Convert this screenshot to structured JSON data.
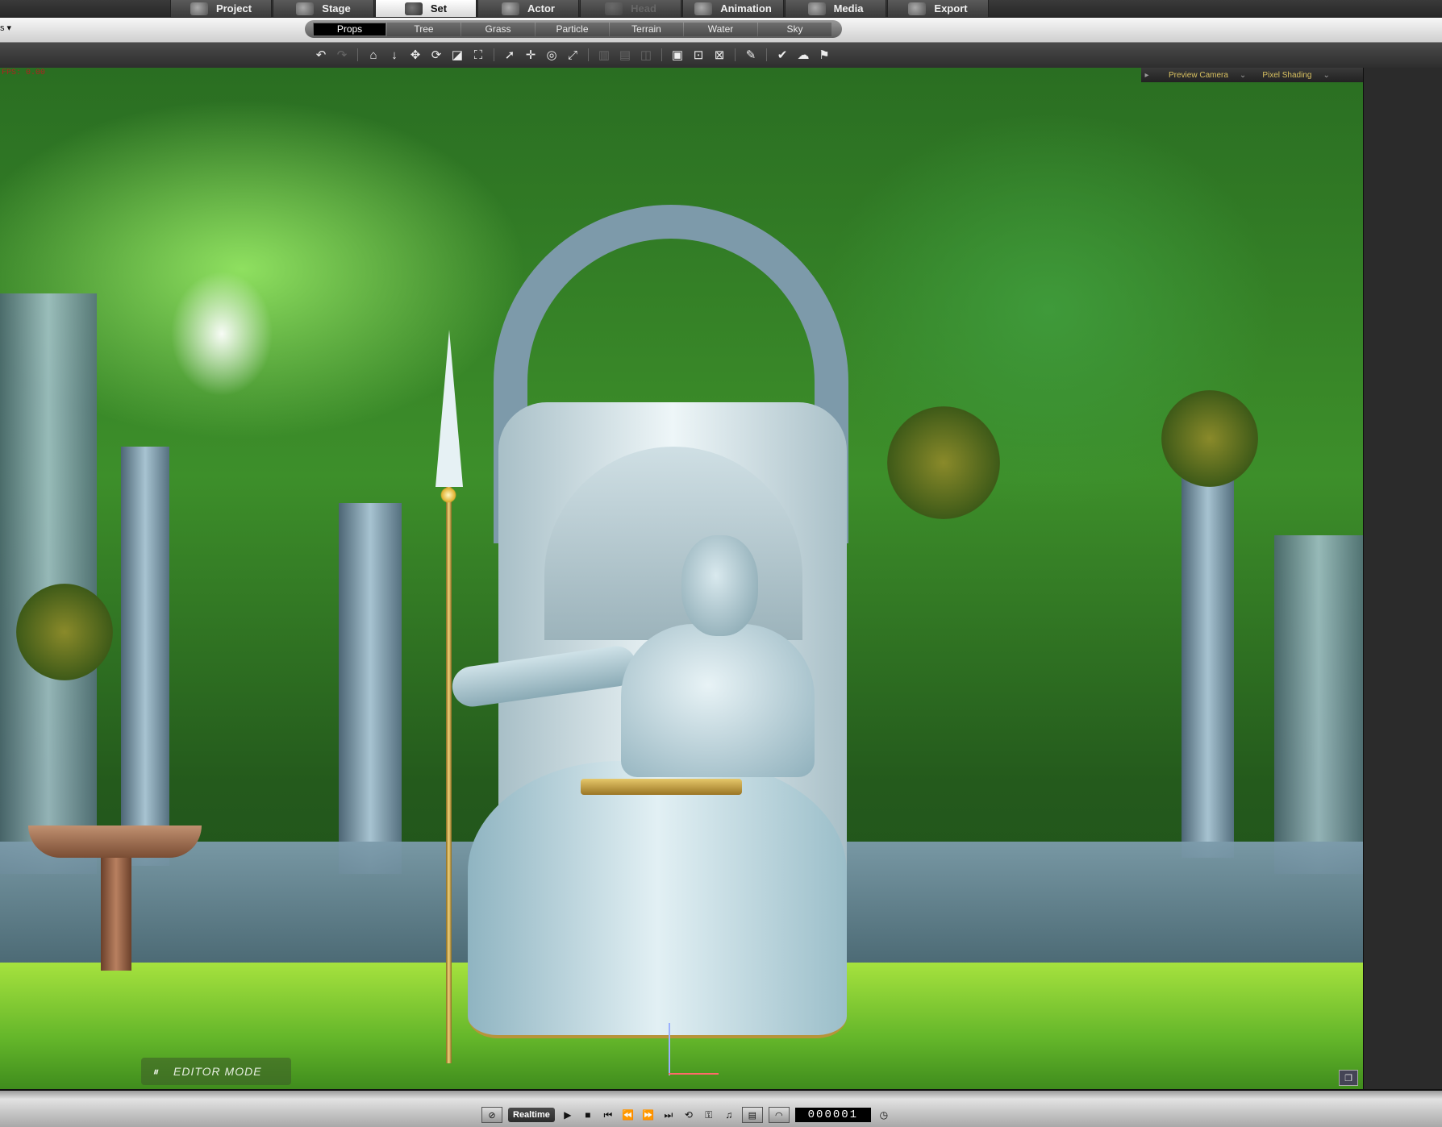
{
  "main_tabs": [
    {
      "label": "Project",
      "icon": "project-icon",
      "state": "normal"
    },
    {
      "label": "Stage",
      "icon": "stage-icon",
      "state": "normal"
    },
    {
      "label": "Set",
      "icon": "set-icon",
      "state": "active"
    },
    {
      "label": "Actor",
      "icon": "actor-icon",
      "state": "normal"
    },
    {
      "label": "Head",
      "icon": "head-icon",
      "state": "disabled"
    },
    {
      "label": "Animation",
      "icon": "animation-icon",
      "state": "normal"
    },
    {
      "label": "Media",
      "icon": "media-icon",
      "state": "normal"
    },
    {
      "label": "Export",
      "icon": "export-icon",
      "state": "normal"
    }
  ],
  "sub_bar": {
    "dropdown_fragment": "s ▾",
    "tabs": [
      "Props",
      "Tree",
      "Grass",
      "Particle",
      "Terrain",
      "Water",
      "Sky"
    ],
    "active_tab": "Props"
  },
  "toolbar": {
    "icons": [
      "undo-icon",
      "redo-icon",
      "home-icon",
      "drop-to-floor-icon",
      "move-icon",
      "rotate-icon",
      "scale-icon",
      "fit-icon",
      "select-icon",
      "pan-icon",
      "orbit-icon",
      "zoom-icon",
      "align-icon",
      "group-icon",
      "camera-view-icon",
      "viewport-layout-icon",
      "frame-selected-icon",
      "light-icon",
      "pick-parent-icon",
      "terrain-icon",
      "flag-icon"
    ]
  },
  "viewport": {
    "fps_text": "FPS: 0.00",
    "camera_label": "Preview Camera",
    "shading_label": "Pixel Shading",
    "mode_label": "EDITOR MODE",
    "accent_color": "#d8c060"
  },
  "playback": {
    "realtime_label": "Realtime",
    "frame_counter": "000001",
    "buttons": [
      "play-icon",
      "stop-icon",
      "first-frame-icon",
      "previous-frame-icon",
      "next-frame-icon",
      "last-frame-icon",
      "loop-icon"
    ]
  }
}
